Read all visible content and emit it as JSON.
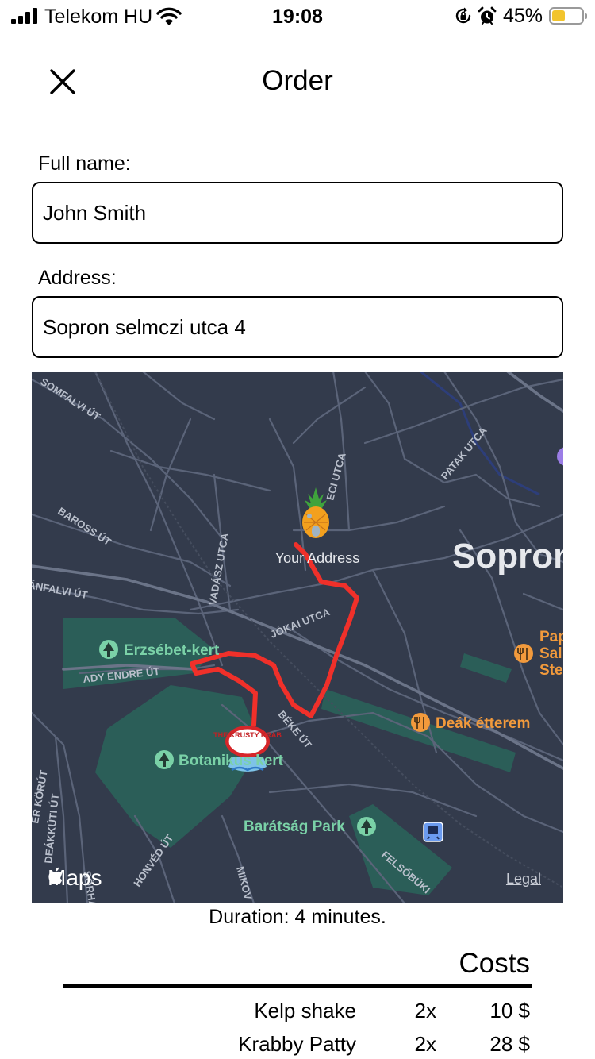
{
  "status_bar": {
    "carrier": "Telekom HU",
    "time": "19:08",
    "battery": "45%",
    "battery_level": 0.45,
    "icons": [
      "signal-icon",
      "wifi-icon",
      "rotation-lock-icon",
      "alarm-icon",
      "battery-icon"
    ]
  },
  "header": {
    "title": "Order",
    "close_icon": "close-icon"
  },
  "form": {
    "name_label": "Full name:",
    "name_value": "John Smith",
    "address_label": "Address:",
    "address_value": "Sopron selmczi utca 4"
  },
  "map": {
    "city_label": "Sopron",
    "your_address_label": "Your Address",
    "streets": [
      "SOMFALVI ÚT",
      "BAROSS ÚT",
      "ÁNFALVI ÚT",
      "VADÁSZ UTCA",
      "ECI UTCA",
      "PATAK UTCA",
      "JÓKAI UTCA",
      "ADY ENDRE ÚT",
      "BÉKE ÚT",
      "ER KÖRÚT",
      "DEÁKKÚTI ÚT",
      "SÓRHAZ",
      "HONVÉD ÚT",
      "MIKOV",
      "FELSŐBÜKI"
    ],
    "pois": {
      "erzsebet": "Erzsébet-kert",
      "botanikus": "Botanikus kert",
      "baratsag": "Barátság Park",
      "deak": "Deák étterem",
      "pap_lines": [
        "Pap",
        "Sal",
        "Ste"
      ]
    },
    "restaurant_logo": "THE KRUSTY KRAB",
    "attribution": "Maps",
    "legal": "Legal",
    "colors": {
      "background": "#333b4c",
      "park": "#2b5e58",
      "route": "#f0302a",
      "poi_green": "#7ad1a7",
      "poi_orange": "#f29a3c"
    }
  },
  "duration": "Duration: 4 minutes.",
  "costs": {
    "title": "Costs",
    "items": [
      {
        "name": "Kelp shake",
        "qty": "2x",
        "price": "10 $"
      },
      {
        "name": "Krabby Patty",
        "qty": "2x",
        "price": "28 $"
      }
    ]
  }
}
